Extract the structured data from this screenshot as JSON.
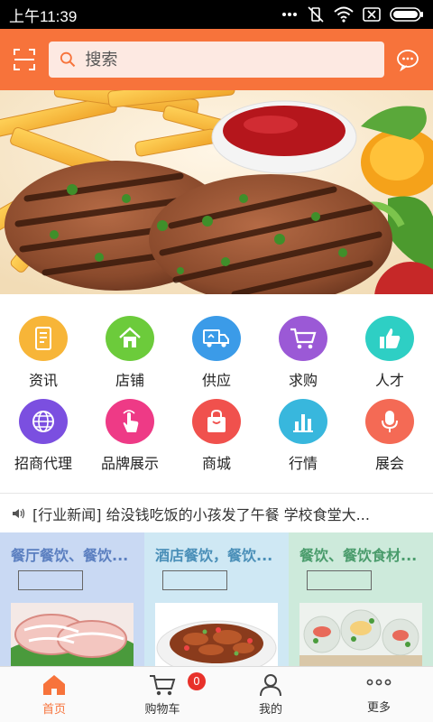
{
  "status_bar": {
    "time": "上午11:39"
  },
  "search": {
    "placeholder": "搜索"
  },
  "categories": [
    {
      "label": "资讯",
      "icon": "document-icon",
      "color": "#f7b538"
    },
    {
      "label": "店铺",
      "icon": "home-icon",
      "color": "#6ccb3b"
    },
    {
      "label": "供应",
      "icon": "delivery-truck-icon",
      "color": "#3b9be8"
    },
    {
      "label": "求购",
      "icon": "shopping-cart-icon",
      "color": "#9b59d6"
    },
    {
      "label": "人才",
      "icon": "thumbs-up-icon",
      "color": "#2ecfc4"
    },
    {
      "label": "招商代理",
      "icon": "globe-icon",
      "color": "#7b4fe0"
    },
    {
      "label": "品牌展示",
      "icon": "tap-hand-icon",
      "color": "#ee3a86"
    },
    {
      "label": "商城",
      "icon": "shopping-bag-icon",
      "color": "#f0514d"
    },
    {
      "label": "行情",
      "icon": "bar-chart-icon",
      "color": "#38b7dd"
    },
    {
      "label": "展会",
      "icon": "microphone-icon",
      "color": "#f46a55"
    }
  ],
  "news": {
    "text": "[行业新闻] 给没钱吃饭的小孩发了午餐 学校食堂大..."
  },
  "promos": [
    {
      "title": "餐厅餐饮、餐饮...",
      "bg": "#c9d9f3",
      "title_color": "#5b7fc0"
    },
    {
      "title": "酒店餐饮，餐饮...",
      "bg": "#cfe8f4",
      "title_color": "#4a8fb8"
    },
    {
      "title": "餐饮、餐饮食材...",
      "bg": "#cdeadb",
      "title_color": "#4a9c6c"
    }
  ],
  "tabs": [
    {
      "label": "首页",
      "icon": "home-icon"
    },
    {
      "label": "购物车",
      "icon": "cart-icon",
      "badge": "0"
    },
    {
      "label": "我的",
      "icon": "user-icon"
    },
    {
      "label": "更多",
      "icon": "more-dots-icon"
    }
  ],
  "colors": {
    "accent": "#f7733b",
    "badge": "#e8312a"
  }
}
